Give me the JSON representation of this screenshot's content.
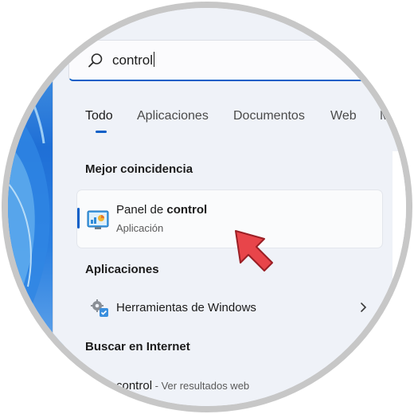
{
  "search": {
    "value": "control"
  },
  "tabs": [
    {
      "label": "Todo",
      "active": true
    },
    {
      "label": "Aplicaciones",
      "active": false
    },
    {
      "label": "Documentos",
      "active": false
    },
    {
      "label": "Web",
      "active": false
    },
    {
      "label": "M",
      "active": false
    }
  ],
  "best_match": {
    "heading": "Mejor coincidencia",
    "name_prefix": "Panel de ",
    "name_highlight": "control",
    "type": "Aplicación",
    "icon": "control-panel-icon"
  },
  "apps": {
    "heading": "Aplicaciones",
    "items": [
      {
        "label": "Herramientas de Windows",
        "icon": "windows-tools-icon"
      }
    ]
  },
  "internet": {
    "heading": "Buscar en Internet",
    "query": "control",
    "suffix": " - Ver resultados web"
  },
  "colors": {
    "accent": "#0a5fc7",
    "pointer": "#e8454a"
  }
}
